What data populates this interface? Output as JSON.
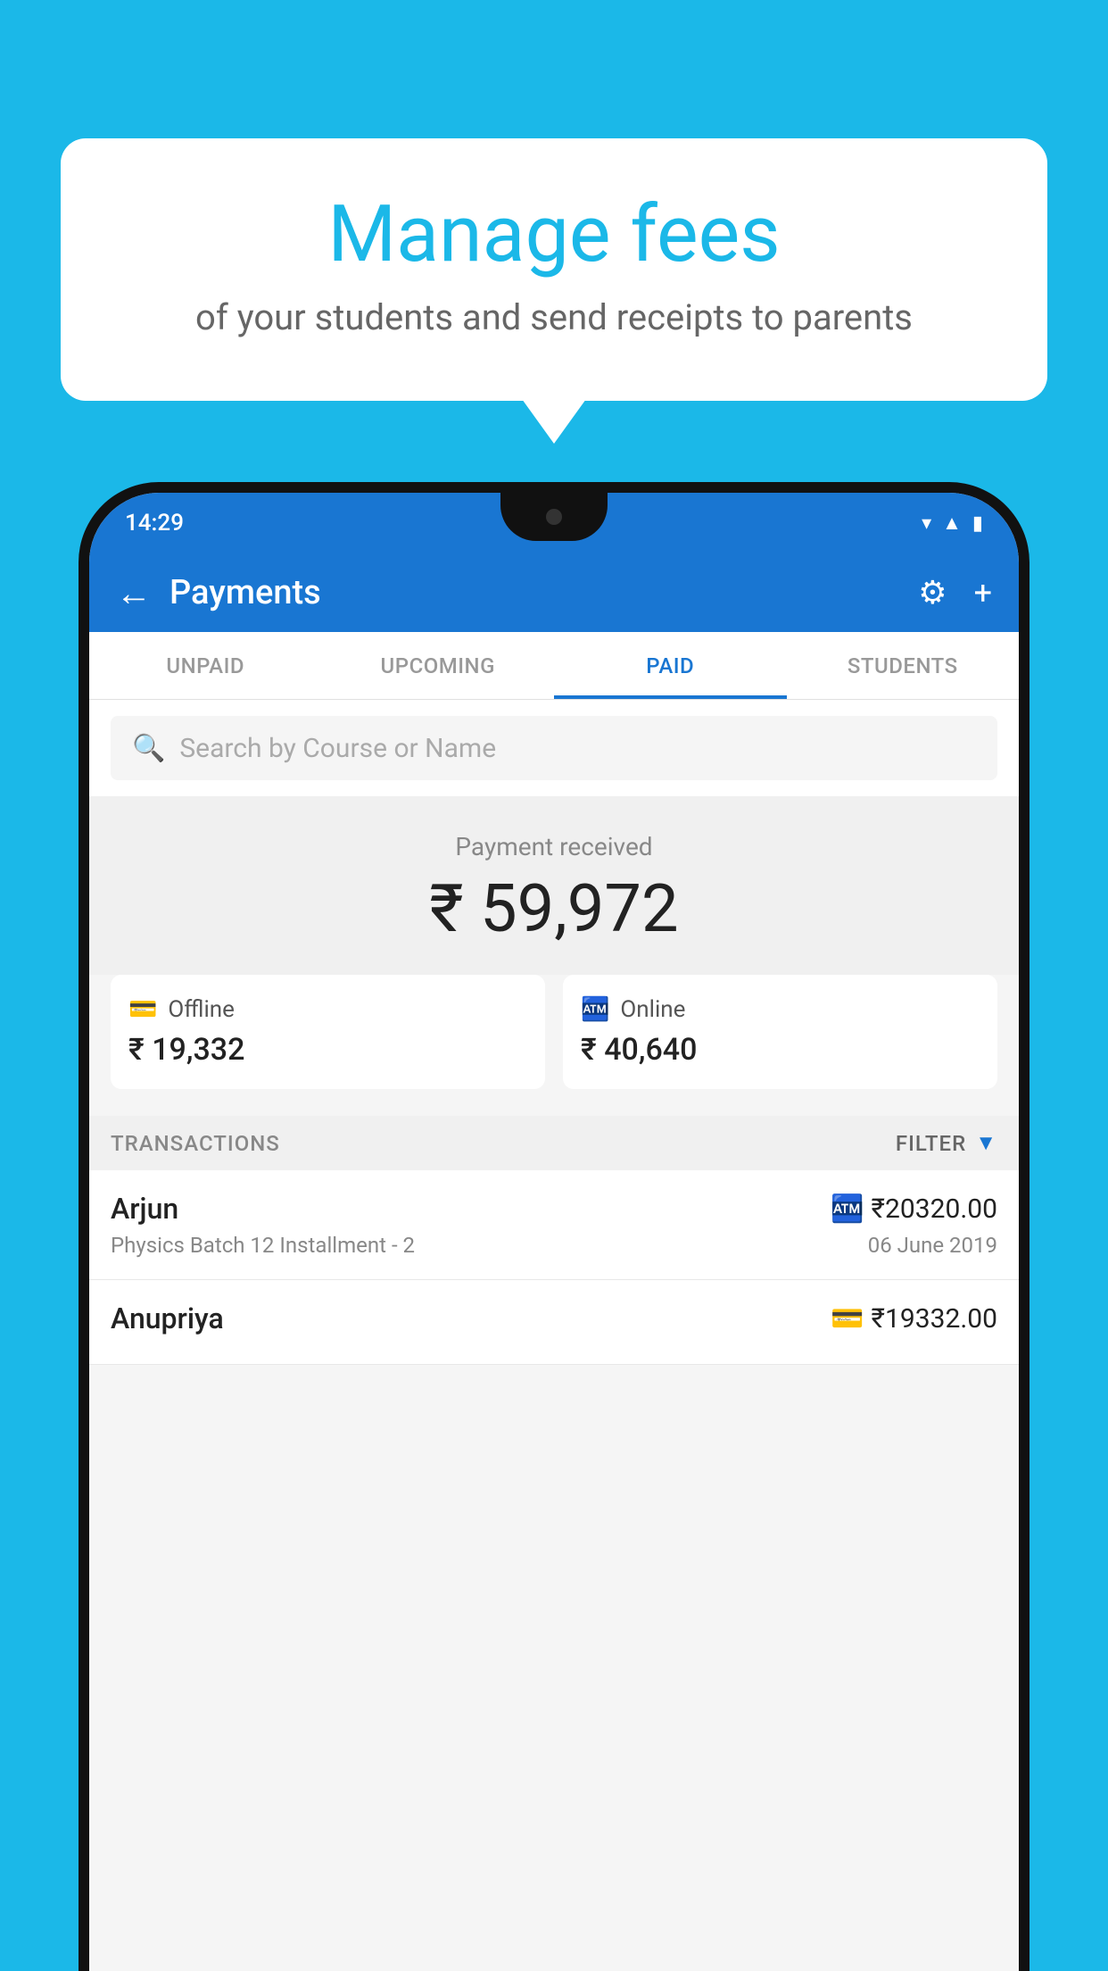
{
  "background_color": "#1BB8E8",
  "bubble": {
    "title": "Manage fees",
    "subtitle": "of your students and send receipts to parents"
  },
  "status_bar": {
    "time": "14:29",
    "icons": [
      "wifi",
      "signal",
      "battery"
    ]
  },
  "header": {
    "title": "Payments",
    "back_label": "←",
    "settings_icon": "gear",
    "add_icon": "+"
  },
  "tabs": [
    {
      "label": "UNPAID",
      "active": false
    },
    {
      "label": "UPCOMING",
      "active": false
    },
    {
      "label": "PAID",
      "active": true
    },
    {
      "label": "STUDENTS",
      "active": false
    }
  ],
  "search": {
    "placeholder": "Search by Course or Name"
  },
  "payment_summary": {
    "label": "Payment received",
    "amount": "₹ 59,972",
    "offline": {
      "label": "Offline",
      "amount": "₹ 19,332"
    },
    "online": {
      "label": "Online",
      "amount": "₹ 40,640"
    }
  },
  "transactions": {
    "header_label": "TRANSACTIONS",
    "filter_label": "FILTER",
    "items": [
      {
        "name": "Arjun",
        "course": "Physics Batch 12 Installment - 2",
        "amount": "₹20320.00",
        "date": "06 June 2019",
        "payment_type": "online"
      },
      {
        "name": "Anupriya",
        "course": "",
        "amount": "₹19332.00",
        "date": "",
        "payment_type": "offline"
      }
    ]
  }
}
